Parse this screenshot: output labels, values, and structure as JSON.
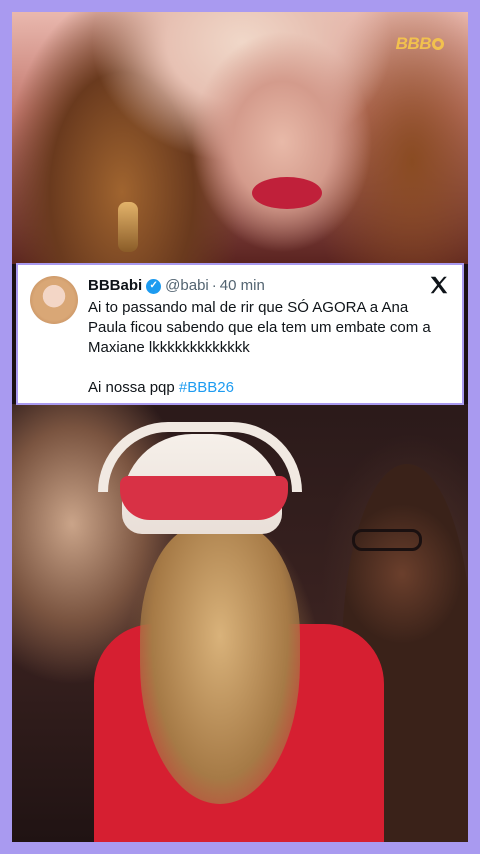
{
  "overlay": {
    "logo": "BBB"
  },
  "tweet": {
    "name": "BBBabi",
    "handle": "@babi",
    "separator": "·",
    "time": "40 min",
    "text": "Ai to passando mal de rir que SÓ AGORA a Ana Paula ficou sabendo que ela tem um embate com a Maxiane lkkkkkkkkkkkkk",
    "text2": "Ai nossa pqp ",
    "hashtag": "#BBB26"
  },
  "colors": {
    "border": "#a99af0",
    "verified": "#1d9bf0",
    "hashtag": "#1d9bf0",
    "logo": "#f2c14e"
  }
}
